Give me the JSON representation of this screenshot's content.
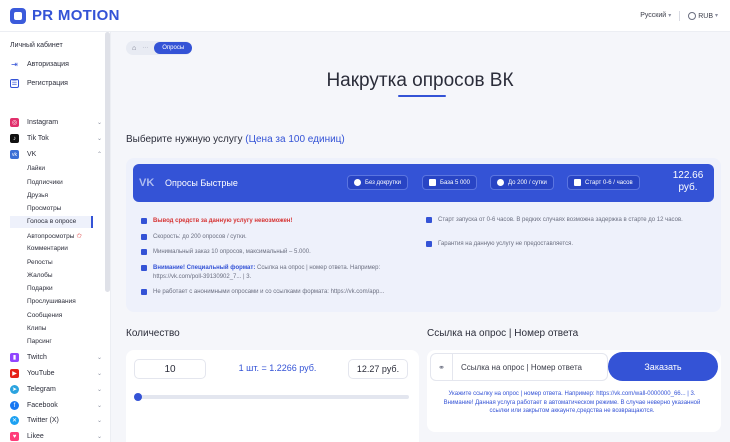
{
  "header": {
    "logo_text": "PR MOTION",
    "language": "Русский",
    "currency": "RUB"
  },
  "sidebar": {
    "top_items": [
      "Личный кабинет",
      "Авторизация",
      "Регистрация"
    ],
    "networks": [
      {
        "label": "Instagram"
      },
      {
        "label": "Tik Tok"
      },
      {
        "label": "VK"
      }
    ],
    "vk_items": [
      "Лайки",
      "Подписчики",
      "Друзья",
      "Просмотры",
      "Голоса в опросе",
      "Автопросмотры",
      "Комментарии",
      "Репосты",
      "Жалобы",
      "Подарки",
      "Прослушивания",
      "Сообщения",
      "Клипы",
      "Парсинг"
    ],
    "more_networks": [
      {
        "label": "Twitch"
      },
      {
        "label": "YouTube"
      },
      {
        "label": "Telegram"
      },
      {
        "label": "Facebook"
      },
      {
        "label": "Twitter (X)"
      },
      {
        "label": "Likee"
      }
    ]
  },
  "breadcrumb": {
    "home_icon": "⌂",
    "dots": "···",
    "current": "Опросы"
  },
  "page": {
    "title": "Накрутка опросов ВК",
    "service_label": "Выберите нужную услугу",
    "service_label_accent": "(Цена за 100 единиц)"
  },
  "service": {
    "name": "Опросы Быстрые",
    "chips": [
      "Без докрутки",
      "База 5 000",
      "До 200 / сутки",
      "Старт 0-6 / часов"
    ],
    "price_value": "122.66",
    "price_unit": "руб.",
    "features_left": [
      {
        "type": "red",
        "text": "Вывод средств за данную услугу невозможен!"
      },
      {
        "type": "plain",
        "text": "Скорость: до 200 опросов / сутки."
      },
      {
        "type": "plain",
        "text": "Минимальный заказ 10 опросов, максимальный – 5.000."
      },
      {
        "type": "blue",
        "bold": "Внимание! Специальный формат:",
        "text": " Ссылка на опрос | номер ответа. Например: https://vk.com/poll-39130902_7... | 3."
      },
      {
        "type": "plain",
        "text": "Не работает с анонимными опросами и со ссылками формата: https://vk.com/app..."
      }
    ],
    "features_right": [
      "Старт запуска от 0-6 часов. В редких случаях возможна задержка в старте до 12 часов.",
      "Гарантия на данную услугу не предоставляется."
    ]
  },
  "quantity": {
    "label": "Количество",
    "value": "10",
    "unit_price": "1 шт. = 1.2266 руб.",
    "total": "12.27 руб.",
    "slider_fraction": 0.0
  },
  "link": {
    "label": "Ссылка на опрос | Номер ответа",
    "placeholder": "Ссылка на опрос | Номер ответа",
    "button": "Заказать",
    "note": "Укажите ссылку на опрос | номер ответа. Например: https://vk.com/wall-0000000_66... | 3. Внимание! Данная услуга работает в автоматическом режиме. В случае неверно указанной ссылки или закрытом аккаунте,средства не возвращаются."
  },
  "colors": {
    "accent": "#3453d6",
    "danger": "#d63333"
  }
}
